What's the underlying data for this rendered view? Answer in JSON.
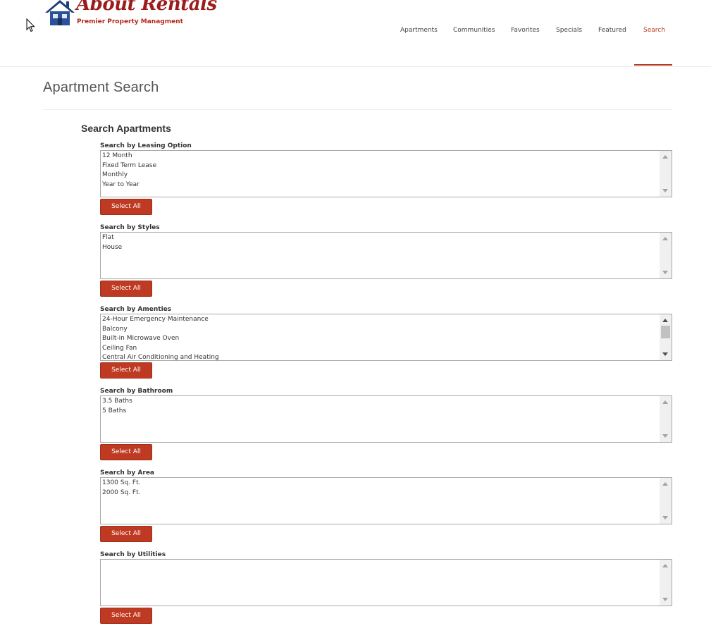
{
  "brand": {
    "title": "About Rentals",
    "subtitle": "Premier Property Managment"
  },
  "nav": [
    {
      "label": "Apartments",
      "active": false
    },
    {
      "label": "Communities",
      "active": false
    },
    {
      "label": "Favorites",
      "active": false
    },
    {
      "label": "Specials",
      "active": false
    },
    {
      "label": "Featured",
      "active": false
    },
    {
      "label": "Search",
      "active": true
    }
  ],
  "page": {
    "title": "Apartment Search",
    "section_title": "Search Apartments"
  },
  "groups": [
    {
      "label": "Search by Leasing Option",
      "button": "Select All",
      "options": [
        "12 Month",
        "Fixed Term Lease",
        "Monthly",
        "Year to Year"
      ]
    },
    {
      "label": "Search by Styles",
      "button": "Select All",
      "options": [
        "Flat",
        "House"
      ]
    },
    {
      "label": "Search by Amenties",
      "button": "Select All",
      "options": [
        "24-Hour Emergency Maintenance",
        "Balcony",
        "Built-in Microwave Oven",
        "Ceiling Fan",
        "Central Air Conditioning and Heating"
      ]
    },
    {
      "label": "Search by Bathroom",
      "button": "Select All",
      "options": [
        "3.5 Baths",
        "5 Baths"
      ]
    },
    {
      "label": "Search by Area",
      "button": "Select All",
      "options": [
        "1300 Sq. Ft.",
        "2000 Sq. Ft."
      ]
    },
    {
      "label": "Search by Utilities",
      "button": "Select All",
      "options": []
    }
  ],
  "colors": {
    "accent": "#bf3a22",
    "brand_red": "#9c1b1b",
    "brand_blue": "#1f3f7a"
  }
}
